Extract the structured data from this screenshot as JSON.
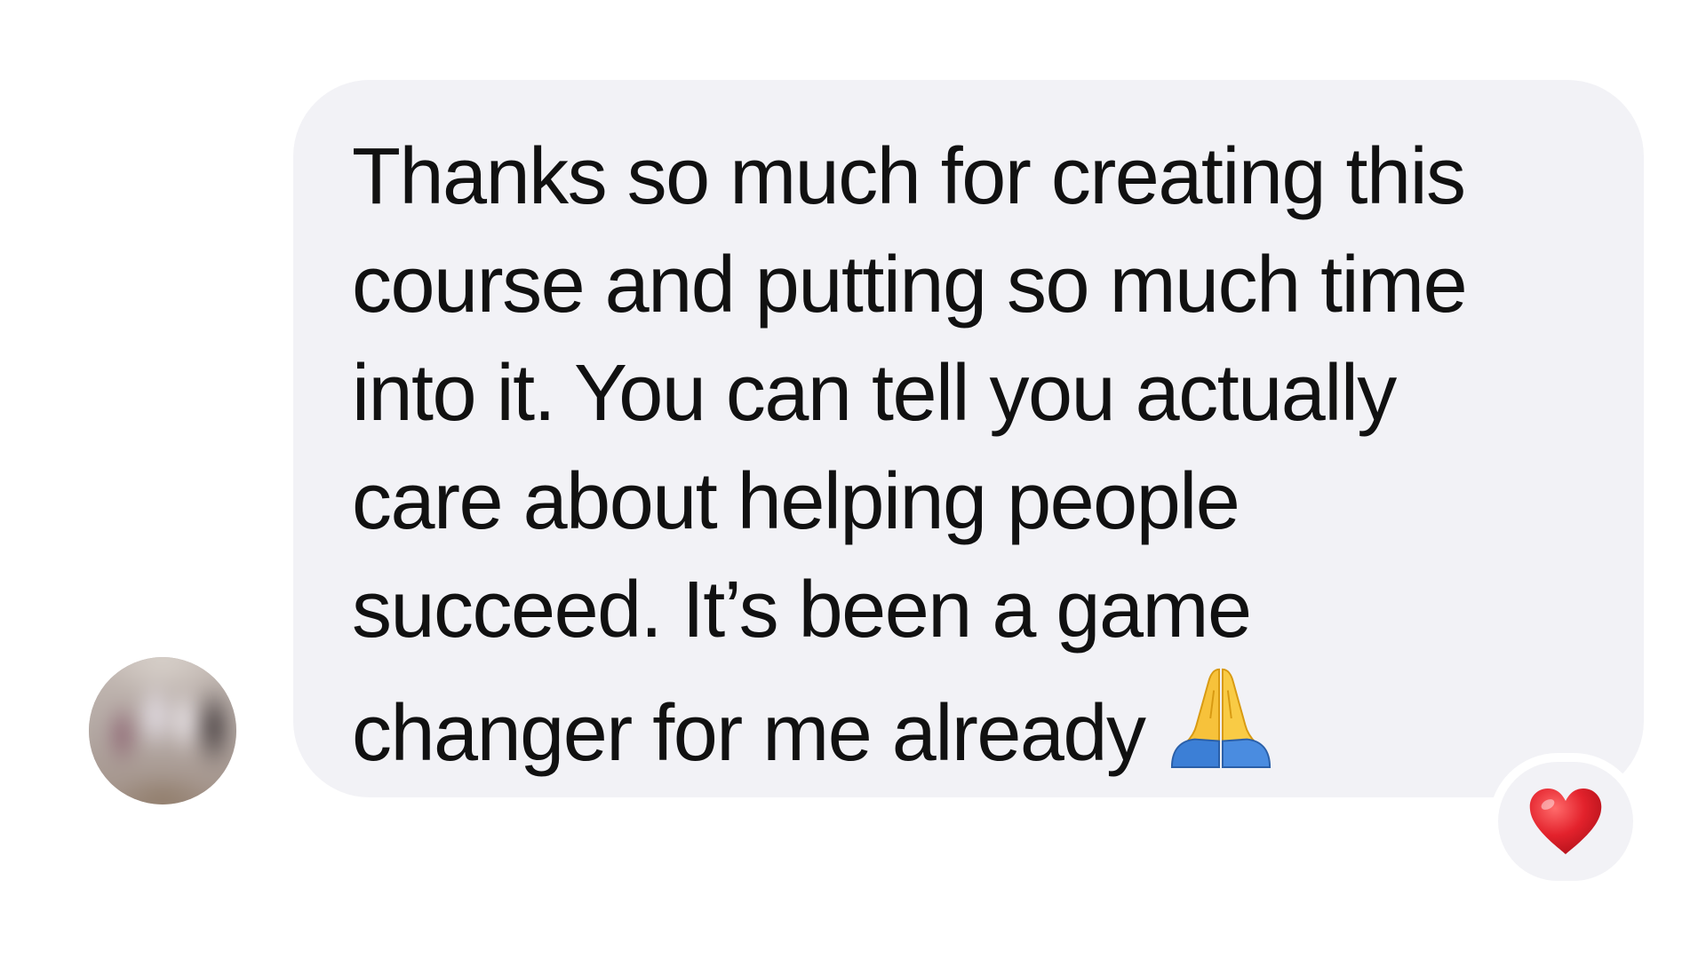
{
  "conversation": {
    "incoming_message": {
      "lines": [
        "Thanks so much for creating this",
        "course and putting so much time",
        "into it. You can tell you actually",
        "care about helping people",
        "succeed. It’s been a game",
        "changer for me already"
      ],
      "trailing_emoji": "praying-hands-icon"
    },
    "reaction": {
      "emoji": "red-heart-icon"
    },
    "sender_avatar": "avatar"
  },
  "colors": {
    "bubble_background": "#f2f2f6",
    "text": "#111111",
    "page_background": "#ffffff",
    "heart": "#e0202a"
  }
}
